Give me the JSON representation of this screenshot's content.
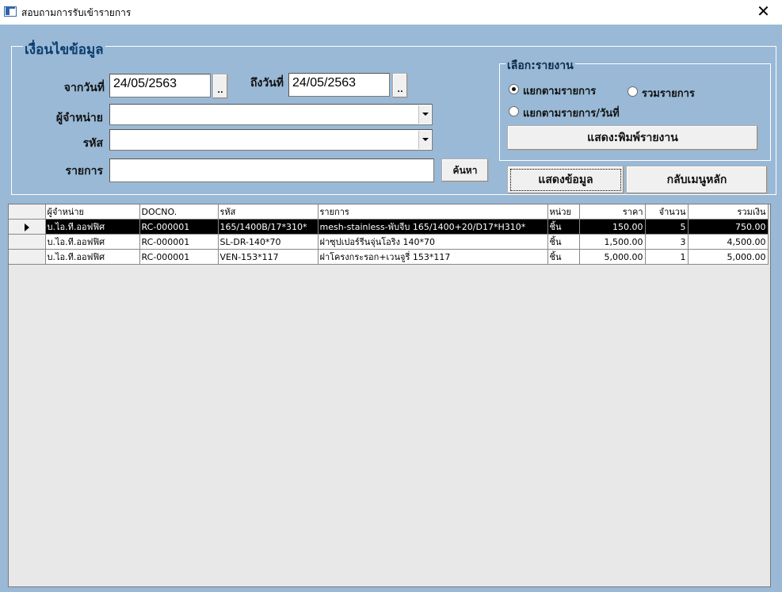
{
  "window": {
    "title": "สอบถามการรับเข้ารายการ"
  },
  "conditions": {
    "legend": "เงื่อนไขข้อมูล",
    "from_label": "จากวันที่",
    "from_value": "24/05/2563",
    "to_label": "ถึงวันที่",
    "to_value": "24/05/2563",
    "date_picker_label": "..",
    "supplier_label": "ผู้จำหน่าย",
    "code_label": "รหัส",
    "item_label": "รายการ",
    "search_button": "ค้นหา"
  },
  "report": {
    "legend": "เลือก:รายงาน",
    "options": [
      {
        "label": "แยกตามรายการ",
        "selected": true
      },
      {
        "label": "รวมรายการ",
        "selected": false
      },
      {
        "label": "แยกตามรายการ/วันที่",
        "selected": false
      }
    ],
    "print_button": "แสดง:พิมพ์รายงาน"
  },
  "actions": {
    "show_data": "แสดงข้อมูล",
    "back_menu": "กลับเมนูหลัก"
  },
  "grid": {
    "columns": [
      "ผู้จำหน่าย",
      "DOCNO.",
      "รหัส",
      "รายการ",
      "หน่วย",
      "ราคา",
      "จำนวน",
      "รวมเงิน"
    ],
    "rows": [
      [
        "บ.ไอ.ที.ออฟฟิศ",
        "RC-000001",
        "165/1400B/17*310*",
        "mesh-stainless-พับจีบ 165/1400+20/D17*H310*",
        "ชิ้น",
        "150.00",
        "5",
        "750.00"
      ],
      [
        "บ.ไอ.ที.ออฟฟิศ",
        "RC-000001",
        "SL-DR-140*70",
        "ฝาซุปเปอร์รีนจุ่นโอริง 140*70",
        "ชิ้น",
        "1,500.00",
        "3",
        "4,500.00"
      ],
      [
        "บ.ไอ.ที.ออฟฟิศ",
        "RC-000001",
        "VEN-153*117",
        "ฝาโครงกระรอก+เวนจูรี่ 153*117",
        "ชิ้น",
        "5,000.00",
        "1",
        "5,000.00"
      ]
    ],
    "selected_row": 0
  }
}
